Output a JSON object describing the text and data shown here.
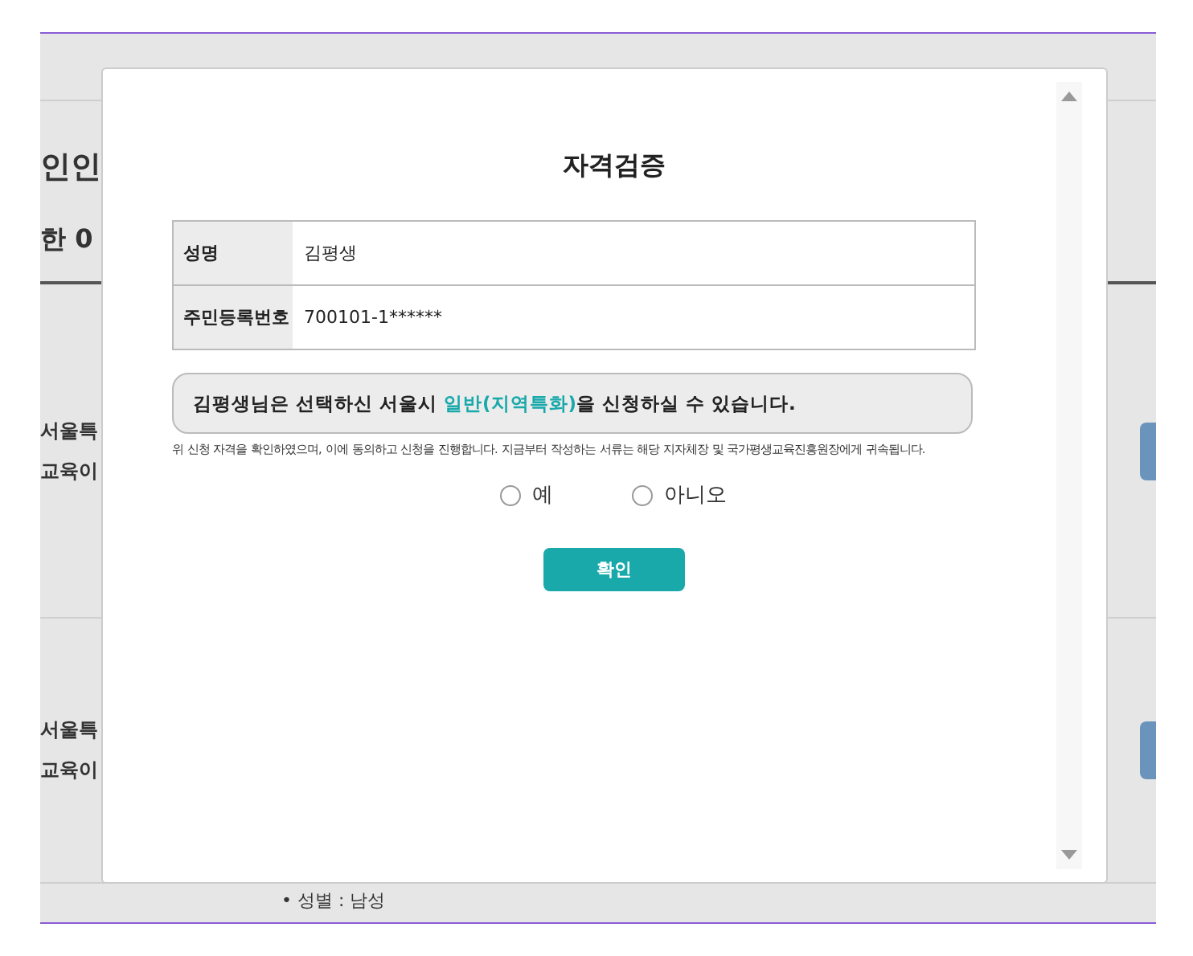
{
  "background": {
    "heading": "인인",
    "subheading": "한 0",
    "rows": [
      {
        "line_1": "서울특",
        "line_2": "교육이"
      },
      {
        "line_1": "서울특",
        "line_2": "교육이"
      }
    ],
    "detail": "• 성별 : 남성"
  },
  "dialog": {
    "title": "자격검증",
    "fields": [
      {
        "label": "성명",
        "value": "김평생"
      },
      {
        "label": "주민등록번호",
        "value": "700101-1******"
      }
    ],
    "notice": {
      "before": "김평생님은 선택하신 서울시 ",
      "highlight": "일반(지역특화)",
      "after": "을 신청하실 수 있습니다."
    },
    "consent": "위 신청 자격을 확인하였으며, 이에 동의하고 신청을 진행합니다. 지금부터 작성하는 서류는 해당 지자체장 및 국가평생교육진흥원장에게 귀속됩니다.",
    "options": [
      {
        "label": "예",
        "selected": false
      },
      {
        "label": "아니오",
        "selected": false
      }
    ],
    "confirm": "확인"
  }
}
